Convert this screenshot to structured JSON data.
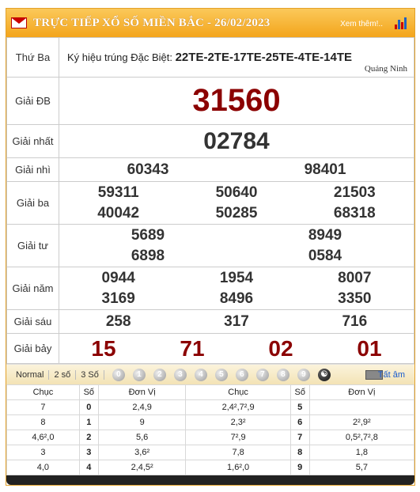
{
  "header": {
    "title": "TRỰC TIẾP XỔ SỐ MIỀN BẮC - 26/02/2023",
    "more_label": "Xem thêm!..",
    "icon": "chart-icon"
  },
  "info": {
    "day": "Thứ Ba",
    "special_code_label": "Ký hiệu trúng Đặc Biệt:",
    "special_codes": "22TE-2TE-17TE-25TE-4TE-14TE",
    "province": "Quảng Ninh"
  },
  "prizes": {
    "db": {
      "label": "Giải ĐB",
      "values": [
        "31560"
      ]
    },
    "nhat": {
      "label": "Giải nhất",
      "values": [
        "02784"
      ]
    },
    "nhi": {
      "label": "Giải nhì",
      "values": [
        "60343",
        "98401"
      ]
    },
    "ba": {
      "label": "Giải ba",
      "values": [
        "59311",
        "50640",
        "21503",
        "40042",
        "50285",
        "68318"
      ]
    },
    "tu": {
      "label": "Giải tư",
      "values": [
        "5689",
        "8949",
        "6898",
        "0584"
      ]
    },
    "nam": {
      "label": "Giải năm",
      "values": [
        "0944",
        "1954",
        "8007",
        "3169",
        "8496",
        "3350"
      ]
    },
    "sau": {
      "label": "Giải sáu",
      "values": [
        "258",
        "317",
        "716"
      ]
    },
    "bay": {
      "label": "Giải bảy",
      "values": [
        "15",
        "71",
        "02",
        "01"
      ]
    }
  },
  "toolbar": {
    "modes": [
      "Normal",
      "2 số",
      "3 Số"
    ],
    "digits": [
      "0",
      "1",
      "2",
      "3",
      "4",
      "5",
      "6",
      "7",
      "8",
      "9"
    ],
    "all_label": "Tất âm"
  },
  "loto": {
    "headers": [
      "Chục",
      "Số",
      "Đơn Vị",
      "Chục",
      "Số",
      "Đơn Vị"
    ],
    "rows": [
      [
        "7",
        "0",
        "2,4,9",
        "2,4²,7²,9",
        "5",
        ""
      ],
      [
        "8",
        "1",
        "9",
        "2,3²",
        "6",
        "2²,9²"
      ],
      [
        "4,6²,0",
        "2",
        "5,6",
        "7²,9",
        "7",
        "0,5²,7²,8"
      ],
      [
        "3",
        "3",
        "3,6²",
        "7,8",
        "8",
        "1,8"
      ],
      [
        "4,0",
        "4",
        "2,4,5²",
        "1,6²,0",
        "9",
        "5,7"
      ]
    ]
  }
}
